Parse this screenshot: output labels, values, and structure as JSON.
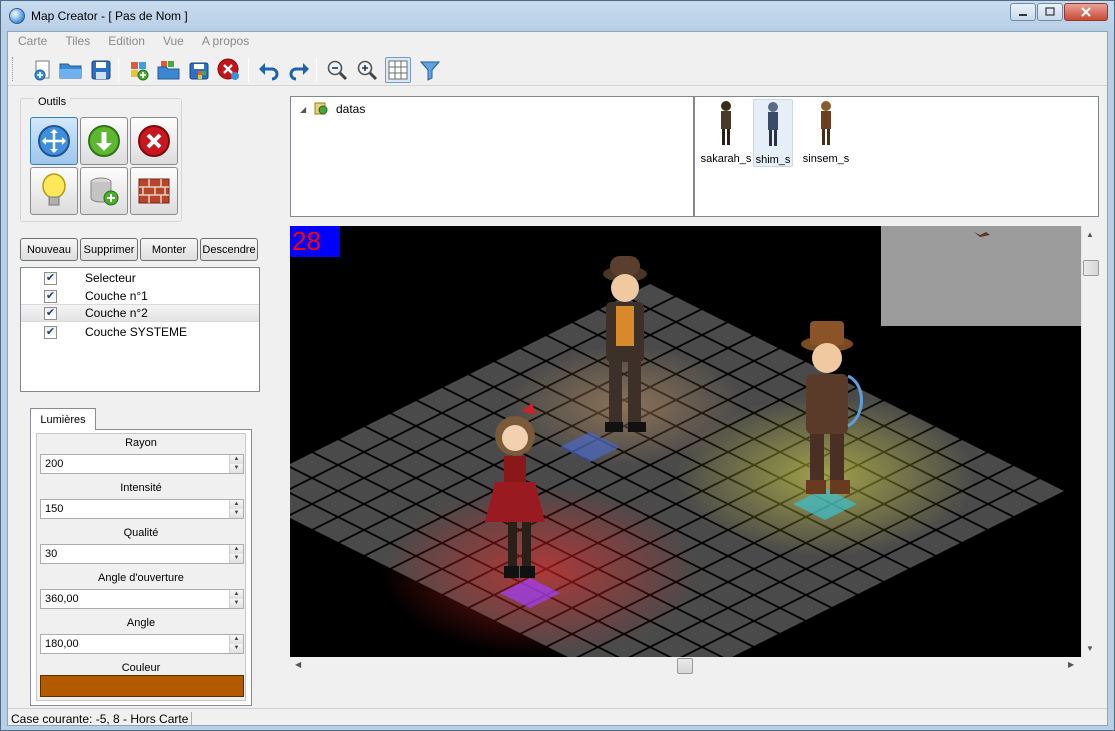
{
  "window": {
    "title": "Map Creator - [ Pas de Nom ]",
    "controls": [
      "minimize",
      "maximize",
      "close"
    ]
  },
  "menu": [
    "Carte",
    "Tiles",
    "Edition",
    "Vue",
    "A propos"
  ],
  "toolbar": {
    "buttons": [
      "new-map-icon",
      "open-folder-icon",
      "save-icon",
      "new-tileset-icon",
      "open-tileset-icon",
      "save-tileset-icon",
      "delete-icon",
      "undo-icon",
      "redo-icon",
      "zoom-out-icon",
      "zoom-in-icon",
      "grid-icon",
      "filter-icon"
    ],
    "active": "grid-icon"
  },
  "tools": {
    "title": "Outils",
    "items": [
      "move-tool-icon",
      "download-tool-icon",
      "erase-tool-icon",
      "light-bulb-icon",
      "database-add-icon",
      "wall-icon"
    ],
    "active": "move-tool-icon"
  },
  "layers": {
    "buttons": [
      "Nouveau",
      "Supprimer",
      "Monter",
      "Descendre"
    ],
    "items": [
      {
        "label": "Selecteur",
        "checked": true
      },
      {
        "label": "Couche n°1",
        "checked": true
      },
      {
        "label": "Couche n°2",
        "checked": true
      },
      {
        "label": "Couche SYSTEME",
        "checked": true
      }
    ],
    "selected_index": 2
  },
  "lights": {
    "tab": "Lumières",
    "fields": [
      {
        "label": "Rayon",
        "value": "200"
      },
      {
        "label": "Intensité",
        "value": "150"
      },
      {
        "label": "Qualité",
        "value": "30"
      },
      {
        "label": "Angle d'ouverture",
        "value": "360,00"
      },
      {
        "label": "Angle",
        "value": "180,00"
      }
    ],
    "color_label": "Couleur",
    "color": "#b35a00"
  },
  "tree": {
    "root": "datas"
  },
  "sprites": {
    "items": [
      "sakarah_s",
      "shim_s",
      "sinsem_s"
    ],
    "selected_index": 1
  },
  "map": {
    "fps": "28",
    "grid_color": "#4a4a4a",
    "minimap_color": "#9c9c9c",
    "lights": [
      {
        "color": "#ff2a2a"
      },
      {
        "color": "#e8e84a"
      },
      {
        "color": "#d9a36a"
      }
    ]
  },
  "status": {
    "text": "Case courante: -5, 8 - Hors Carte"
  }
}
